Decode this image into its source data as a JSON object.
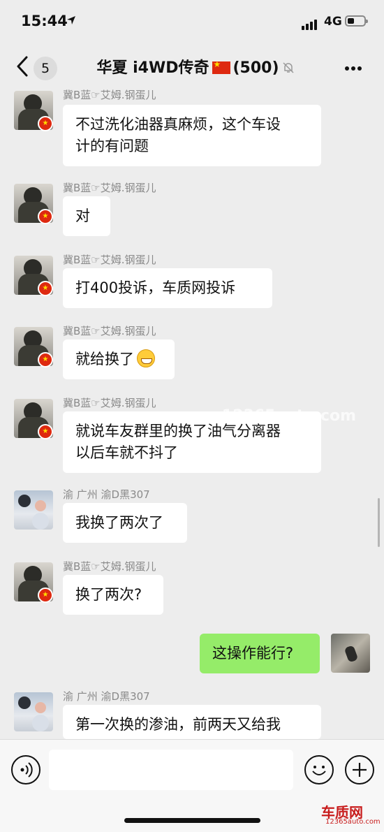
{
  "status_bar": {
    "time": "15:44",
    "network": "4G",
    "battery_percent": 40
  },
  "nav": {
    "back_count": "5",
    "title_prefix": "华夏 i4WD传奇",
    "title_count": "(500)"
  },
  "messages": [
    {
      "sender": "冀B蓝☞艾姆.钢蛋儿",
      "lines": [
        "不过洗化油器真麻烦，这个车设",
        "计的有问题"
      ],
      "avatar": "soldier"
    },
    {
      "sender": "冀B蓝☞艾姆.钢蛋儿",
      "lines": [
        "对"
      ],
      "avatar": "soldier"
    },
    {
      "sender": "冀B蓝☞艾姆.钢蛋儿",
      "lines": [
        "打400投诉，车质网投诉"
      ],
      "avatar": "soldier"
    },
    {
      "sender": "冀B蓝☞艾姆.钢蛋儿",
      "lines": [
        "就给换了"
      ],
      "avatar": "soldier",
      "emoji": "grin-emoji"
    },
    {
      "sender": "冀B蓝☞艾姆.钢蛋儿",
      "lines": [
        "就说车友群里的换了油气分离器",
        "以后车就不抖了"
      ],
      "avatar": "soldier"
    },
    {
      "sender": "渝 广州 渝D黑307",
      "lines": [
        "我换了两次了"
      ],
      "avatar": "kids"
    },
    {
      "sender": "冀B蓝☞艾姆.钢蛋儿",
      "lines": [
        "换了两次?"
      ],
      "avatar": "soldier"
    },
    {
      "sender": "",
      "lines": [
        "这操作能行?"
      ],
      "avatar": "me",
      "mine": true
    },
    {
      "sender": "渝 广州 渝D黑307",
      "lines": [
        "第一次换的渗油，前两天又给我"
      ],
      "avatar": "kids"
    }
  ],
  "watermark": "www.12365auto.com",
  "brand": {
    "name": "车质网",
    "url": "12365auto.com"
  },
  "icons": {
    "voice": "voice-icon",
    "emoji": "emoji-icon",
    "add": "add-icon",
    "mute": "bell-mute-icon"
  },
  "colors": {
    "background": "#ededed",
    "bubble": "#ffffff",
    "my_bubble": "#95ec69",
    "flag": "#de2910"
  }
}
